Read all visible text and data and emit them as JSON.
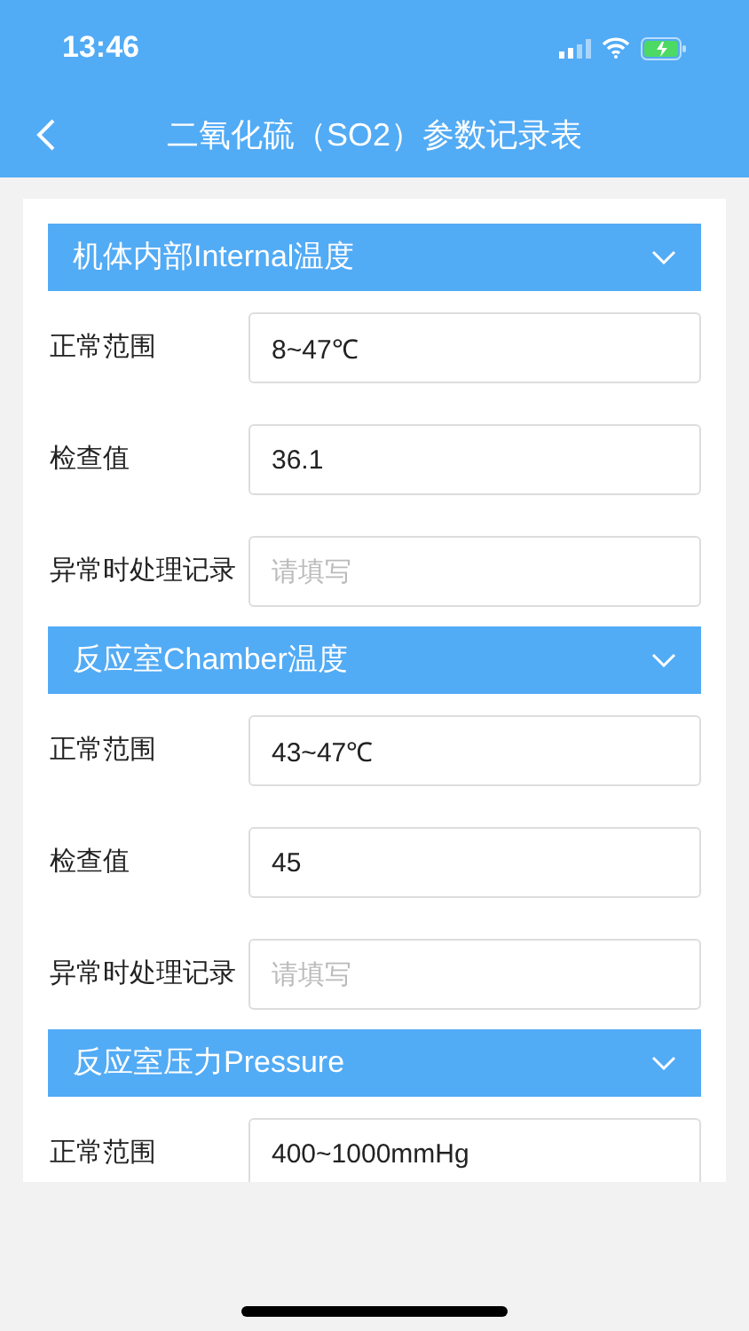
{
  "status_bar": {
    "time": "13:46"
  },
  "nav": {
    "title": "二氧化硫（SO2）参数记录表"
  },
  "sections": [
    {
      "title": "机体内部Internal温度",
      "expanded": true,
      "rows": [
        {
          "label": "正常范围",
          "value": "8~47℃"
        },
        {
          "label": "检查值",
          "value": "36.1"
        },
        {
          "label": "异常时处理记录",
          "placeholder": "请填写"
        }
      ]
    },
    {
      "title": "反应室Chamber温度",
      "expanded": true,
      "rows": [
        {
          "label": "正常范围",
          "value": "43~47℃"
        },
        {
          "label": "检查值",
          "value": "45"
        },
        {
          "label": "异常时处理记录",
          "placeholder": "请填写"
        }
      ]
    },
    {
      "title": "反应室压力Pressure",
      "expanded": true,
      "rows": [
        {
          "label": "正常范围",
          "value": "400~1000mmHg"
        }
      ]
    }
  ]
}
